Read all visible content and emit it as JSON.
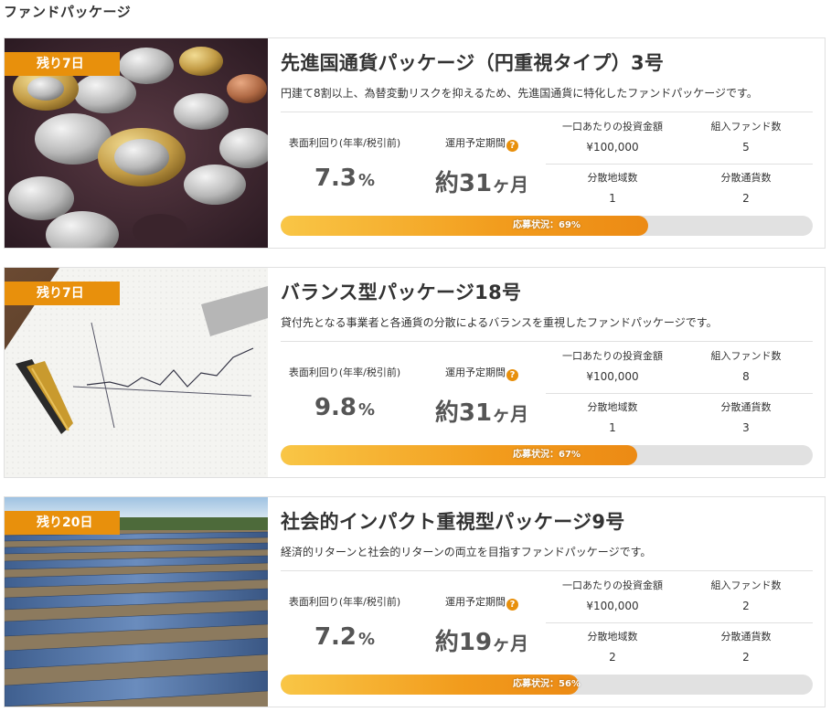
{
  "section": {
    "title": "ファンドパッケージ"
  },
  "labels": {
    "rate": "表面利回り(年率/税引前)",
    "period": "運用予定期間",
    "amount": "一口あたりの投資金額",
    "funds": "組入ファンド数",
    "regions": "分散地域数",
    "currencies": "分散通貨数",
    "help_icon": "?"
  },
  "packages": [
    {
      "badge": "残り7日",
      "image": "coins-photo",
      "title": "先進国通貨パッケージ（円重視タイプ）3号",
      "description": "円建て8割以上、為替変動リスクを抑えるため、先進国通貨に特化したファンドパッケージです。",
      "rate": "7.3",
      "rate_unit": "%",
      "period": "約31",
      "period_unit": "ヶ月",
      "amount": "¥100,000",
      "funds": "5",
      "regions": "1",
      "currencies": "2",
      "progress_text": "応募状況：69%",
      "progress": 0.69
    },
    {
      "badge": "残り7日",
      "image": "chart-paper-photo",
      "title": "バランス型パッケージ18号",
      "description": "貸付先となる事業者と各通貨の分散によるバランスを重視したファンドパッケージです。",
      "rate": "9.8",
      "rate_unit": "%",
      "period": "約31",
      "period_unit": "ヶ月",
      "amount": "¥100,000",
      "funds": "8",
      "regions": "1",
      "currencies": "3",
      "progress_text": "応募状況：67%",
      "progress": 0.67
    },
    {
      "badge": "残り20日",
      "image": "solar-panels-photo",
      "title": "社会的インパクト重視型パッケージ9号",
      "description": "経済的リターンと社会的リターンの両立を目指すファンドパッケージです。",
      "rate": "7.2",
      "rate_unit": "%",
      "period": "約19",
      "period_unit": "ヶ月",
      "amount": "¥100,000",
      "funds": "2",
      "regions": "2",
      "currencies": "2",
      "progress_text": "応募状況：56%",
      "progress": 0.56
    }
  ],
  "colors": {
    "accent": "#e8900c",
    "progress_start": "#f9c646",
    "progress_end": "#ec8a14",
    "track": "#e1e1e1"
  }
}
